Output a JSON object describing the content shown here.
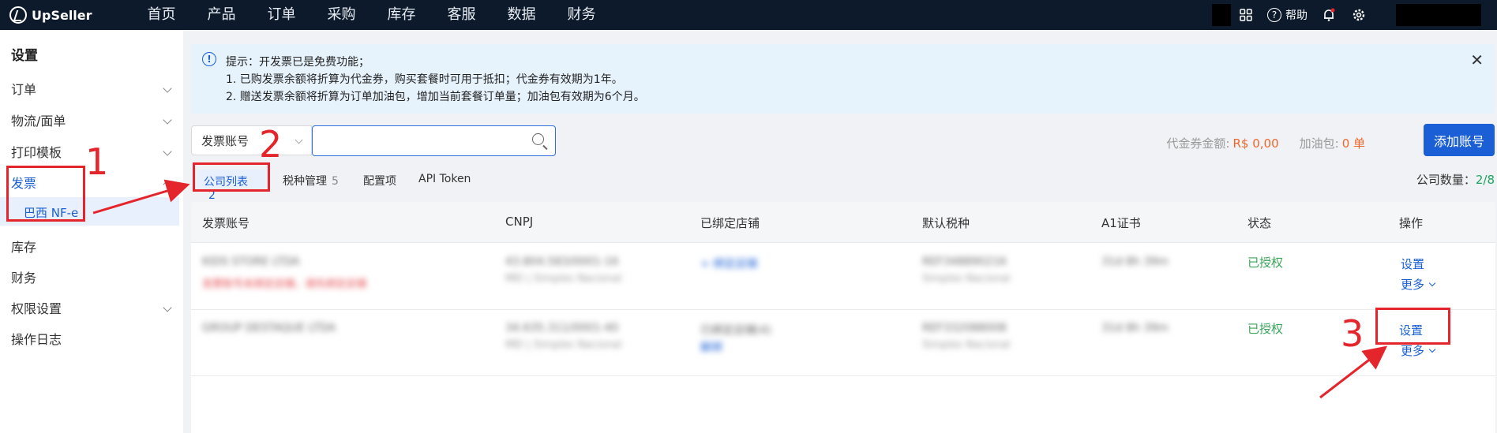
{
  "app": {
    "name": "UpSeller"
  },
  "nav": [
    "首页",
    "产品",
    "订单",
    "采购",
    "库存",
    "客服",
    "数据",
    "财务"
  ],
  "topRight": {
    "help": "帮助"
  },
  "sidebar": {
    "title": "设置",
    "items": [
      {
        "label": "订单"
      },
      {
        "label": "物流/面单"
      },
      {
        "label": "打印模板"
      },
      {
        "label": "发票"
      },
      {
        "label": "库存"
      },
      {
        "label": "财务"
      },
      {
        "label": "权限设置"
      },
      {
        "label": "操作日志"
      }
    ],
    "subItem": "巴西 NF-e"
  },
  "alert": {
    "line1": "提示：开发票已是免费功能；",
    "line2": "1. 已购发票余额将折算为代金券，购买套餐时可用于抵扣；代金券有效期为1年。",
    "line3": "2. 赠送发票余额将折算为订单加油包，增加当前套餐订单量；加油包有效期为6个月。"
  },
  "toolbar": {
    "select": "发票账号",
    "searchPlaceholder": "",
    "voucherLabel": "代金券金额:",
    "voucherValue": "R$ 0,00",
    "boostLabel": "加油包:",
    "boostValue": "0 单",
    "addButton": "添加账号"
  },
  "tabs": [
    {
      "label": "公司列表",
      "count": "2"
    },
    {
      "label": "税种管理",
      "count": "5"
    },
    {
      "label": "配置项",
      "count": ""
    },
    {
      "label": "API Token",
      "count": ""
    }
  ],
  "companyCount": {
    "label": "公司数量：",
    "value": "2/8"
  },
  "table": {
    "headers": [
      "发票账号",
      "CNPJ",
      "已绑定店铺",
      "默认税种",
      "A1证书",
      "状态",
      "操作"
    ],
    "rows": [
      {
        "account": "KIDS STORE LTDA",
        "accountNote": "发票账号未绑定店铺，请先绑定店铺",
        "cnpj": "43.804.583/0001-16",
        "cnpjSub": "MEI | Simples Nacional",
        "store": "+ 绑定店铺",
        "storeSub": "",
        "tax": "REF348890216",
        "taxSub": "Simples Nacional",
        "cert": "31d 8h 39m",
        "status": "已授权",
        "op": "设置",
        "more": "更多"
      },
      {
        "account": "GROUP DESTAQUE LTDA",
        "accountNote": "",
        "cnpj": "34.635.311/0001-40",
        "cnpjSub": "MEI | Simples Nacional",
        "store": "已绑定店铺(4)",
        "storeSub": "解绑",
        "tax": "REF332088008",
        "taxSub": "Simples Nacional",
        "cert": "31d 8h 39m",
        "status": "已授权",
        "op": "设置",
        "more": "更多"
      }
    ]
  },
  "annotations": [
    "1",
    "2",
    "3"
  ],
  "colors": {
    "accent": "#1a5fd6",
    "topbar": "#0c1a2c",
    "annotation": "#e4262c",
    "success": "#3aa55a",
    "warning": "#f2662c"
  }
}
